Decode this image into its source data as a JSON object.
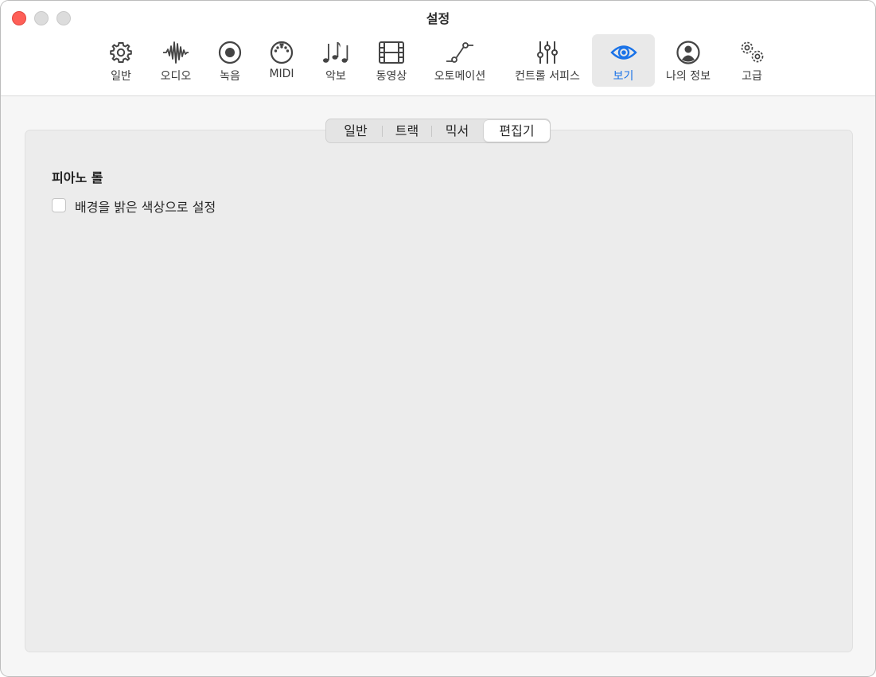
{
  "window": {
    "title": "설정"
  },
  "toolbar": {
    "items": [
      {
        "label": "일반",
        "icon": "gear-icon"
      },
      {
        "label": "오디오",
        "icon": "waveform-icon"
      },
      {
        "label": "녹음",
        "icon": "record-icon"
      },
      {
        "label": "MIDI",
        "icon": "midi-connector-icon"
      },
      {
        "label": "악보",
        "icon": "music-notes-icon"
      },
      {
        "label": "동영상",
        "icon": "film-icon"
      },
      {
        "label": "오토메이션",
        "icon": "automation-curve-icon"
      },
      {
        "label": "컨트롤 서피스",
        "icon": "faders-icon"
      },
      {
        "label": "보기",
        "icon": "eye-icon",
        "selected": true
      },
      {
        "label": "나의 정보",
        "icon": "person-icon"
      },
      {
        "label": "고급",
        "icon": "gears-icon"
      }
    ]
  },
  "tabs": [
    {
      "label": "일반"
    },
    {
      "label": "트랙"
    },
    {
      "label": "믹서"
    },
    {
      "label": "편집기",
      "active": true
    }
  ],
  "section": {
    "title": "피아노 롤",
    "checkbox_label": "배경을 밝은 색상으로 설정",
    "checked": false
  },
  "colors": {
    "accent": "#1a73e8",
    "close": "#fe5f57",
    "inactive_traffic": "#dcdcdc"
  }
}
